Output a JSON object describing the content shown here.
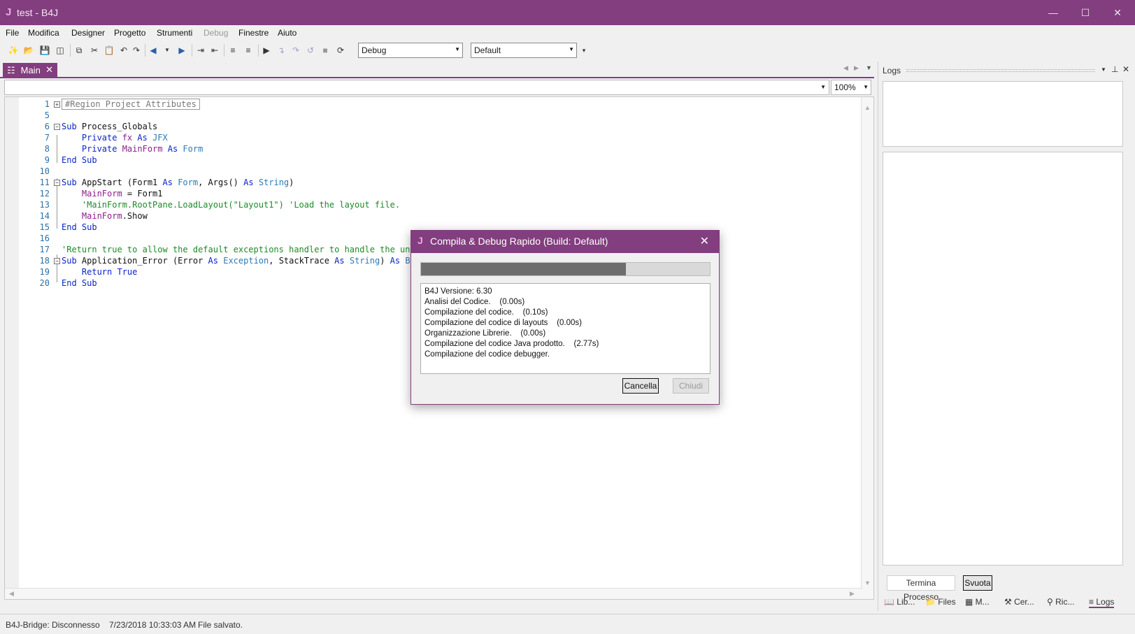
{
  "window": {
    "title": "test - B4J",
    "controls": [
      "minimize",
      "maximize",
      "close"
    ]
  },
  "menu": [
    "File",
    "Modifica",
    "Designer",
    "Progetto",
    "Strumenti",
    "Debug",
    "Finestre",
    "Aiuto"
  ],
  "toolbar": {
    "build_config": "Debug",
    "build_target": "Default"
  },
  "editor": {
    "tab_label": "Main",
    "zoom": "100%",
    "lines": [
      {
        "num": "1",
        "segments": [
          {
            "t": "#Region Project Attributes",
            "c": "region"
          }
        ],
        "fold": "+"
      },
      {
        "num": "5",
        "segments": [
          {
            "t": "",
            "c": "ident"
          }
        ]
      },
      {
        "num": "6",
        "segments": [
          {
            "t": "Sub ",
            "c": "kw"
          },
          {
            "t": "Process_Globals",
            "c": "ident"
          }
        ],
        "fold": "-"
      },
      {
        "num": "7",
        "segments": [
          {
            "t": "    Private ",
            "c": "kw"
          },
          {
            "t": "fx",
            "c": "va"
          },
          {
            "t": " As ",
            "c": "kw"
          },
          {
            "t": "JFX",
            "c": "ty"
          }
        ]
      },
      {
        "num": "8",
        "segments": [
          {
            "t": "    Private ",
            "c": "kw"
          },
          {
            "t": "MainForm",
            "c": "va"
          },
          {
            "t": " As ",
            "c": "kw"
          },
          {
            "t": "Form",
            "c": "ty"
          }
        ]
      },
      {
        "num": "9",
        "segments": [
          {
            "t": "End Sub",
            "c": "kw"
          }
        ]
      },
      {
        "num": "10",
        "segments": [
          {
            "t": "",
            "c": "ident"
          }
        ]
      },
      {
        "num": "11",
        "segments": [
          {
            "t": "Sub ",
            "c": "kw"
          },
          {
            "t": "AppStart",
            "c": "ident"
          },
          {
            "t": " (Form1 ",
            "c": "ident"
          },
          {
            "t": "As ",
            "c": "kw"
          },
          {
            "t": "Form",
            "c": "ty"
          },
          {
            "t": ", Args() ",
            "c": "ident"
          },
          {
            "t": "As ",
            "c": "kw"
          },
          {
            "t": "String",
            "c": "ty"
          },
          {
            "t": ")",
            "c": "ident"
          }
        ],
        "fold": "-"
      },
      {
        "num": "12",
        "segments": [
          {
            "t": "    ",
            "c": "ident"
          },
          {
            "t": "MainForm",
            "c": "va"
          },
          {
            "t": " = Form1",
            "c": "ident"
          }
        ]
      },
      {
        "num": "13",
        "segments": [
          {
            "t": "    'MainForm.RootPane.LoadLayout(\"Layout1\") 'Load the layout file.",
            "c": "cm"
          }
        ]
      },
      {
        "num": "14",
        "segments": [
          {
            "t": "    ",
            "c": "ident"
          },
          {
            "t": "MainForm",
            "c": "va"
          },
          {
            "t": ".Show",
            "c": "ident"
          }
        ]
      },
      {
        "num": "15",
        "segments": [
          {
            "t": "End Sub",
            "c": "kw"
          }
        ]
      },
      {
        "num": "16",
        "segments": [
          {
            "t": "",
            "c": "ident"
          }
        ]
      },
      {
        "num": "17",
        "segments": [
          {
            "t": "'Return true to allow the default exceptions handler to handle the uncau",
            "c": "cm"
          }
        ]
      },
      {
        "num": "18",
        "segments": [
          {
            "t": "Sub ",
            "c": "kw"
          },
          {
            "t": "Application_Error",
            "c": "ident"
          },
          {
            "t": " (Error ",
            "c": "ident"
          },
          {
            "t": "As ",
            "c": "kw"
          },
          {
            "t": "Exception",
            "c": "ty"
          },
          {
            "t": ", StackTrace ",
            "c": "ident"
          },
          {
            "t": "As ",
            "c": "kw"
          },
          {
            "t": "String",
            "c": "ty"
          },
          {
            "t": ") ",
            "c": "ident"
          },
          {
            "t": "As ",
            "c": "kw"
          },
          {
            "t": "Bool",
            "c": "ty"
          }
        ],
        "fold": "-"
      },
      {
        "num": "19",
        "segments": [
          {
            "t": "    Return True",
            "c": "kw"
          }
        ]
      },
      {
        "num": "20",
        "segments": [
          {
            "t": "End Sub",
            "c": "kw"
          }
        ]
      }
    ]
  },
  "logs": {
    "title": "Logs",
    "terminate_label": "Termina Processo",
    "clear_label": "Svuota",
    "bottom_tabs": [
      "Lib...",
      "Files",
      "M...",
      "Cer...",
      "Ric...",
      "Logs"
    ]
  },
  "status": {
    "bridge": "B4J-Bridge: Disconnesso",
    "timestamp": "7/23/2018 10:33:03 AM",
    "message": "File salvato."
  },
  "dialog": {
    "title": "Compila & Debug Rapido (Build: Default)",
    "progress": 0.71,
    "log_lines": [
      "B4J Versione: 6.30",
      "Analisi del Codice.    (0.00s)",
      "Compilazione del codice.    (0.10s)",
      "Compilazione del codice di layouts    (0.00s)",
      "Organizzazione Librerie.    (0.00s)",
      "Compilazione del codice Java prodotto.    (2.77s)",
      "Compilazione del codice debugger."
    ],
    "cancel_label": "Cancella",
    "close_label": "Chiudi"
  },
  "colors": {
    "accent": "#823e7e",
    "keyword": "#0b24c8",
    "type": "#2b7bb6",
    "variable": "#8b1e8c",
    "comment": "#1d8a2a"
  }
}
